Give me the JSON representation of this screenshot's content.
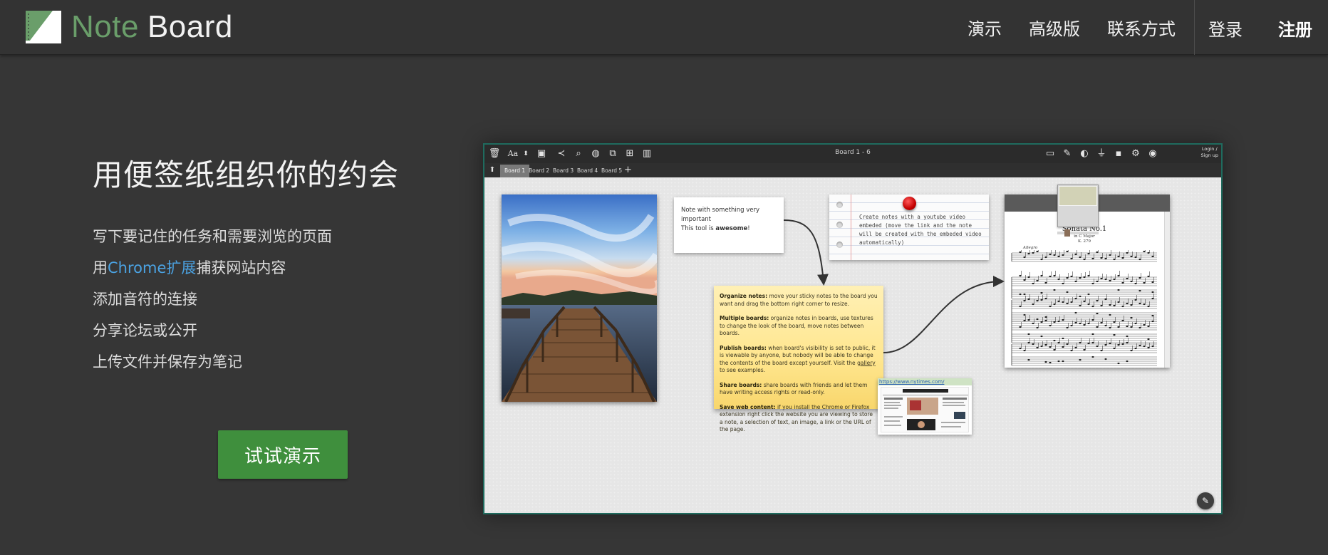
{
  "header": {
    "logo_note": "Note",
    "logo_board": "Board",
    "nav": [
      "演示",
      "高级版",
      "联系方式"
    ],
    "login": "登录",
    "register": "注册"
  },
  "hero": {
    "title": "用便签纸组织你的约会",
    "features": {
      "f1": "写下要记住的任务和需要浏览的页面",
      "f2_prefix": "用",
      "f2_link": "Chrome扩展",
      "f2_suffix": "捕获网站内容",
      "f3": "添加音符的连接",
      "f4": "分享论坛或公开",
      "f5": "上传文件并保存为笔记"
    },
    "cta": "试试演示"
  },
  "preview": {
    "board_title": "Board 1 - 6",
    "login_line1": "Login /",
    "login_line2": "Sign up",
    "font_label": "Aa",
    "tabs": [
      "Board 1",
      "Board 2",
      "Board 3",
      "Board 4",
      "Board 5"
    ],
    "add_tab": "+",
    "note_white": {
      "line1": "Note with something very important",
      "line2_prefix": "This tool is ",
      "line2_bold": "awesome",
      "line2_suffix": "!"
    },
    "note_lined": "Create notes with a youtube video embeded (move the link and the note will be created with the embeded video automatically)",
    "note_yellow": {
      "p1_title": "Organize notes:",
      "p1_text": " move your sticky notes to the board you want and drag the bottom right corner to resize.",
      "p2_title": "Multiple boards:",
      "p2_text": " organize notes in boards, use textures to change the look of the board, move notes between boards.",
      "p3_title": "Publish boards:",
      "p3_text_a": " when board's visibility is set to public, it is viewable by anyone, but nobody will be able to change the contents of the board except yourself. Visit the ",
      "p3_link": "gallery",
      "p3_text_b": " to see examples.",
      "p4_title": "Share boards:",
      "p4_text": " share boards with friends and let them have writing access rights or read-only.",
      "p5_title": "Save web content:",
      "p5_text": " if you install the Chrome or Firefox extension right click the website you are viewing to store a note, a selection of text, an image, a link or the URL of the page."
    },
    "sheet": {
      "composer": "Mozart",
      "title": "Sonata No.1",
      "key": "in C Major",
      "catalog": "K. 279",
      "tempo": "Allegro"
    },
    "web_note_url": "https://www.nytimes.com/",
    "colors": {
      "board_bg": "#e6e6e6",
      "frame_border": "#1f6b5e",
      "cta_green": "#3f8f3d",
      "link_blue": "#4ba3e3",
      "logo_green": "#6a9e6a"
    }
  }
}
